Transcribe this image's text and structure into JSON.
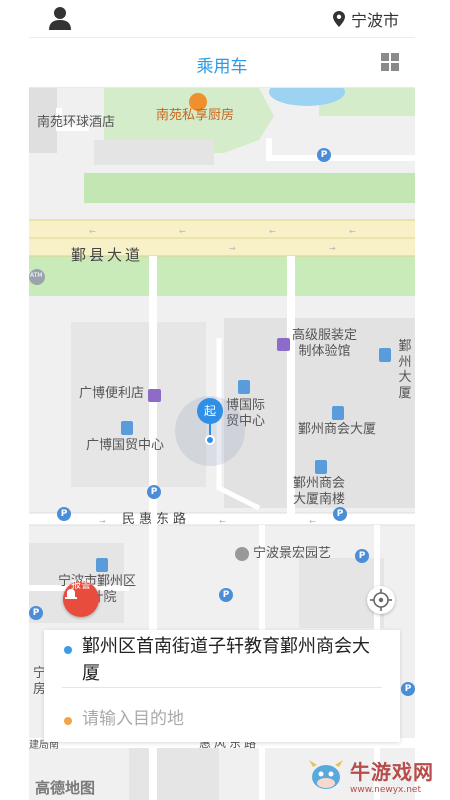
{
  "header": {
    "city": "宁波市",
    "title": "乘用车"
  },
  "map": {
    "labels": {
      "nanyuan_hotel": "南苑环球酒店",
      "nanyuan_kitchen": "南苑私享厨房",
      "yinxian_road": "鄞县大道",
      "atm": "ATM",
      "clothing": "高级服装定\n制体验馆",
      "yinzhou_right": "鄞州\n大厦",
      "guangbo_store": "广博便利店",
      "guangbo_intl": "博国际\n贸中心",
      "guangbo_trade": "广博国贸中心",
      "chamber": "鄞州商会大厦",
      "chamber_south": "鄞州商会\n大厦南楼",
      "minhui_road": "民惠东路",
      "jinghong": "宁波景宏园艺",
      "design_inst": "宁波市鄞州区\n设计院",
      "left_edge": "宁\n房",
      "bottom_road": "惠风东路",
      "bottom_left": "建局南",
      "amap": "高德地图"
    },
    "pickup_marker": "起",
    "sos_label": "报警"
  },
  "trip": {
    "from_address": "鄞州区首南街道子轩教育鄞州商会大厦",
    "to_placeholder": "请输入目的地"
  },
  "watermark": {
    "name": "牛游戏网",
    "url": "www.newyx.net"
  }
}
